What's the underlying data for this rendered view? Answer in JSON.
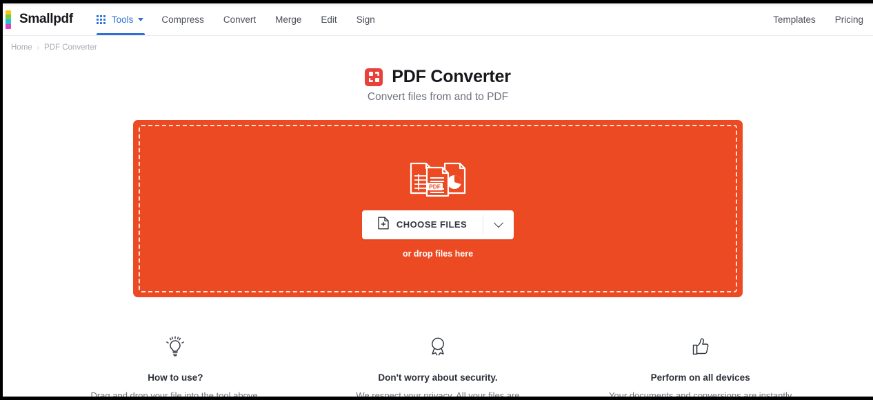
{
  "brand": {
    "name": "Smallpdf",
    "logo_colors": [
      "#f5c518",
      "#7ac943",
      "#22c1d6",
      "#e040c0"
    ]
  },
  "nav": {
    "tools": {
      "label": "Tools",
      "icon": "grid-icon",
      "caret": "chevron-down-icon",
      "active": true
    },
    "items": [
      {
        "label": "Compress"
      },
      {
        "label": "Convert"
      },
      {
        "label": "Merge"
      },
      {
        "label": "Edit"
      },
      {
        "label": "Sign"
      }
    ],
    "right_items": [
      {
        "label": "Templates"
      },
      {
        "label": "Pricing"
      }
    ]
  },
  "breadcrumb": {
    "home": "Home",
    "separator": "›",
    "current": "PDF Converter"
  },
  "hero": {
    "title": "PDF Converter",
    "subtitle": "Convert files from and to PDF",
    "icon_color": "#e8403a"
  },
  "dropzone": {
    "background_color": "#ec4a22",
    "choose_label": "CHOOSE FILES",
    "choose_icon": "file-plus-icon",
    "caret_icon": "chevron-down-icon",
    "drop_hint": "or drop files here",
    "illustration": "documents-pdf-illustration",
    "pdf_badge": "PDF"
  },
  "features": [
    {
      "icon": "lightbulb-icon",
      "title": "How to use?",
      "desc": "Drag and drop your file into the tool above."
    },
    {
      "icon": "award-ribbon-icon",
      "title": "Don't worry about security.",
      "desc": "We respect your privacy. All your files are"
    },
    {
      "icon": "thumbs-up-icon",
      "title": "Perform on all devices",
      "desc": "Your documents and conversions are instantly"
    }
  ]
}
